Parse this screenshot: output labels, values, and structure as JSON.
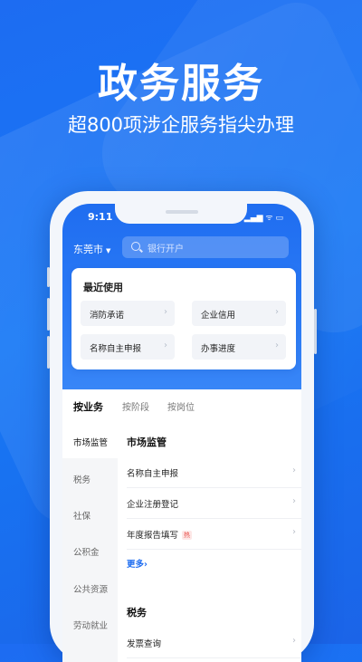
{
  "promo": {
    "headline": "政务服务",
    "subline": "超800项涉企服务指尖办理"
  },
  "status_bar": {
    "time": "9:11",
    "icons": "▂▄▆ ᯤ ▭"
  },
  "header": {
    "city": "东莞市",
    "search_placeholder": "银行开户"
  },
  "recent": {
    "title": "最近使用",
    "items": [
      {
        "label": "消防承诺"
      },
      {
        "label": "企业信用"
      },
      {
        "label": "名称自主申报"
      },
      {
        "label": "办事进度"
      }
    ]
  },
  "tabs": [
    {
      "label": "按业务"
    },
    {
      "label": "按阶段"
    },
    {
      "label": "按岗位"
    }
  ],
  "left_nav": [
    {
      "label": "市场监管"
    },
    {
      "label": "税务"
    },
    {
      "label": "社保"
    },
    {
      "label": "公积金"
    },
    {
      "label": "公共资源"
    },
    {
      "label": "劳动就业"
    }
  ],
  "sections": {
    "market": {
      "title": "市场监管",
      "rows": [
        {
          "label": "名称自主申报"
        },
        {
          "label": "企业注册登记"
        },
        {
          "label": "年度报告填写",
          "badge": "热"
        }
      ],
      "more": "更多"
    },
    "tax": {
      "title": "税务",
      "rows": [
        {
          "label": "发票查询"
        }
      ]
    }
  },
  "colors": {
    "brand_blue": "#1f6df0",
    "hot_badge": "#e8504a"
  }
}
